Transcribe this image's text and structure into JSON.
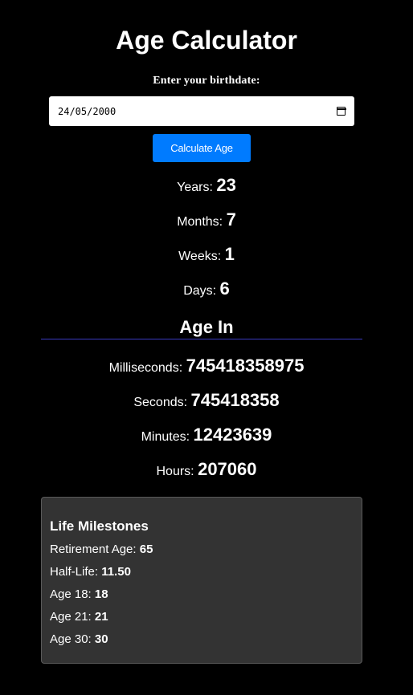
{
  "header": {
    "title": "Age Calculator",
    "birthdate_label": "Enter your birthdate:"
  },
  "birthdate_input": {
    "value": "24/05/2000",
    "icon": "calendar-icon"
  },
  "calculate_button_label": "Calculate Age",
  "age": {
    "years_label": "Years:",
    "years": "23",
    "months_label": "Months:",
    "months": "7",
    "weeks_label": "Weeks:",
    "weeks": "1",
    "days_label": "Days:",
    "days": "6"
  },
  "age_in": {
    "title": "Age In",
    "milliseconds_label": "Milliseconds:",
    "milliseconds": "745418358975",
    "seconds_label": "Seconds:",
    "seconds": "745418358",
    "minutes_label": "Minutes:",
    "minutes": "12423639",
    "hours_label": "Hours:",
    "hours": "207060"
  },
  "milestones": {
    "title": "Life Milestones",
    "retirement_label": "Retirement Age:",
    "retirement": "65",
    "half_life_label": "Half-Life:",
    "half_life": "11.50",
    "age18_label": "Age 18:",
    "age18": "18",
    "age21_label": "Age 21:",
    "age21": "21",
    "age30_label": "Age 30:",
    "age30": "30"
  },
  "colors": {
    "background": "#000000",
    "button": "#007bff",
    "divider": "#3a3ac0",
    "panel": "#333333"
  }
}
